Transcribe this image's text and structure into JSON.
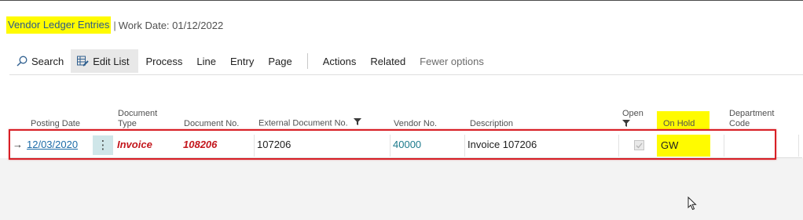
{
  "page": {
    "title": "Vendor Ledger Entries",
    "separator": "|",
    "work_date": "Work Date: 01/12/2022"
  },
  "actions": [
    {
      "label": "Search",
      "icon": "search-icon"
    },
    {
      "label": "Edit List",
      "icon": "edit-list-icon"
    },
    {
      "label": "Process"
    },
    {
      "label": "Line"
    },
    {
      "label": "Entry"
    },
    {
      "label": "Page"
    },
    {
      "label": "Actions"
    },
    {
      "label": "Related"
    },
    {
      "label": "Fewer options"
    }
  ],
  "columns": {
    "posting_date": "Posting Date",
    "document_type_1": "Document",
    "document_type_2": "Type",
    "document_no": "Document No.",
    "external_document_no": "External Document No.",
    "vendor_no": "Vendor No.",
    "description": "Description",
    "open": "Open",
    "on_hold": "On Hold",
    "department_code_1": "Department",
    "department_code_2": "Code"
  },
  "row": {
    "posting_date": "12/03/2020",
    "document_type": "Invoice",
    "document_no": "108206",
    "external_document_no": "107206",
    "vendor_no": "40000",
    "description": "Invoice 107206",
    "open": true,
    "on_hold": "GW",
    "department_code": ""
  },
  "colors": {
    "highlight": "#fffb00",
    "selection_border": "#d81f26",
    "link": "#1d6ca8",
    "document_red": "#c3161c"
  }
}
